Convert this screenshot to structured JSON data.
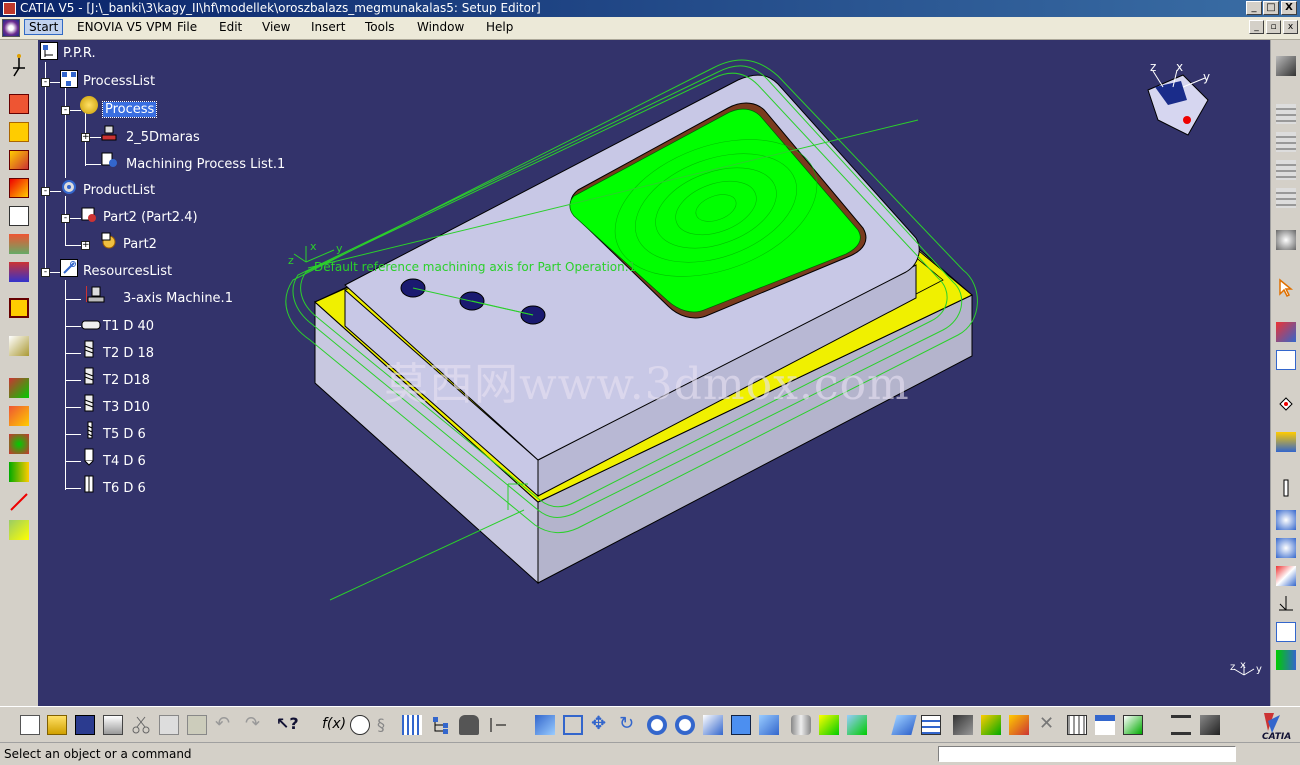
{
  "window": {
    "title": "CATIA V5 - [J:\\_banki\\3\\kagy_II\\hf\\modellek\\oroszbalazs_megmunakalas5: Setup Editor]",
    "min_label": "_",
    "max_label": "□",
    "close_label": "X"
  },
  "menu": {
    "items": [
      "Start",
      "ENOVIA V5 VPM",
      "File",
      "Edit",
      "View",
      "Insert",
      "Tools",
      "Window",
      "Help"
    ],
    "mdi_min": "_",
    "mdi_restore": "▫",
    "mdi_close": "x"
  },
  "tree": {
    "root": "P.P.R.",
    "process_list": "ProcessList",
    "process": "Process",
    "process_child1": "2_5Dmaras",
    "process_child2": "Machining Process List.1",
    "product_list": "ProductList",
    "product_part": "Part2 (Part2.4)",
    "product_sub": "Part2",
    "resources_list": "ResourcesList",
    "machine": "3-axis Machine.1",
    "tools": [
      "T1 D 40",
      "T2  D 18",
      "T2  D18",
      "T3  D10",
      "T5 D 6",
      "T4 D 6",
      "T6 D 6"
    ]
  },
  "viewport": {
    "axis_caption": "Default reference machining axis for Part Operation.1",
    "axis_labels": {
      "z": "z",
      "x": "x",
      "y": "y"
    },
    "watermark": "莫西网www.3dmox.com",
    "background_color": "#33336b",
    "pocket_color": "#00ff00",
    "stock_color": "#f0f000",
    "part_color": "#c8c8e6",
    "toolpath_color": "#2bd02b"
  },
  "toolbar_icons": {
    "left": [
      "setup-icon",
      "part-operation-icon",
      "manufacturing-program-icon",
      "machining-process-icon",
      "insert-program-icon",
      "tool-change-icon",
      "machine-rotation-icon",
      "catalog-icon",
      "open-process-icon",
      "rough-stock-icon",
      "creates-stock-icon",
      "transition-patch-icon",
      "geometry-icon",
      "cutting-icon",
      "tool-path-icon"
    ],
    "bottom": [
      "new-icon",
      "open-icon",
      "save-icon",
      "print-icon",
      "cut-icon",
      "copy-icon",
      "paste-icon",
      "undo-icon",
      "redo-icon",
      "help-icon",
      "formula-icon",
      "search-icon",
      "knowledge-icon",
      "table-icon",
      "tree-icon",
      "lock-icon",
      "distance-icon",
      "fly-icon",
      "fit-all-icon",
      "pan-icon",
      "rotate-icon",
      "zoom-in-icon",
      "zoom-out-icon",
      "normal-view-icon",
      "iso-view-icon",
      "shading-icon",
      "hide-show-icon",
      "swap-icon",
      "render-icon",
      "material-icon",
      "parameters-icon",
      "compile-icon",
      "feature-icon",
      "simulate-icon",
      "delete-icon",
      "table2-icon",
      "output-icon",
      "nc-code-icon",
      "mfg-view-icon",
      "catia-logo-icon"
    ],
    "right": [
      "machine-icon",
      "cylinder1-icon",
      "cylinder2-icon",
      "cylinder3-icon",
      "cylinder4-icon",
      "pattern-icon",
      "select-arrow-icon",
      "options-icon",
      "document-icon",
      "point-icon",
      "axis-icon",
      "drill-icon",
      "group-icon",
      "program-icon",
      "transform-icon",
      "coordinates-icon",
      "report-icon",
      "scale-icon"
    ]
  },
  "status": {
    "message": "Select an object or a command",
    "command_value": ""
  }
}
